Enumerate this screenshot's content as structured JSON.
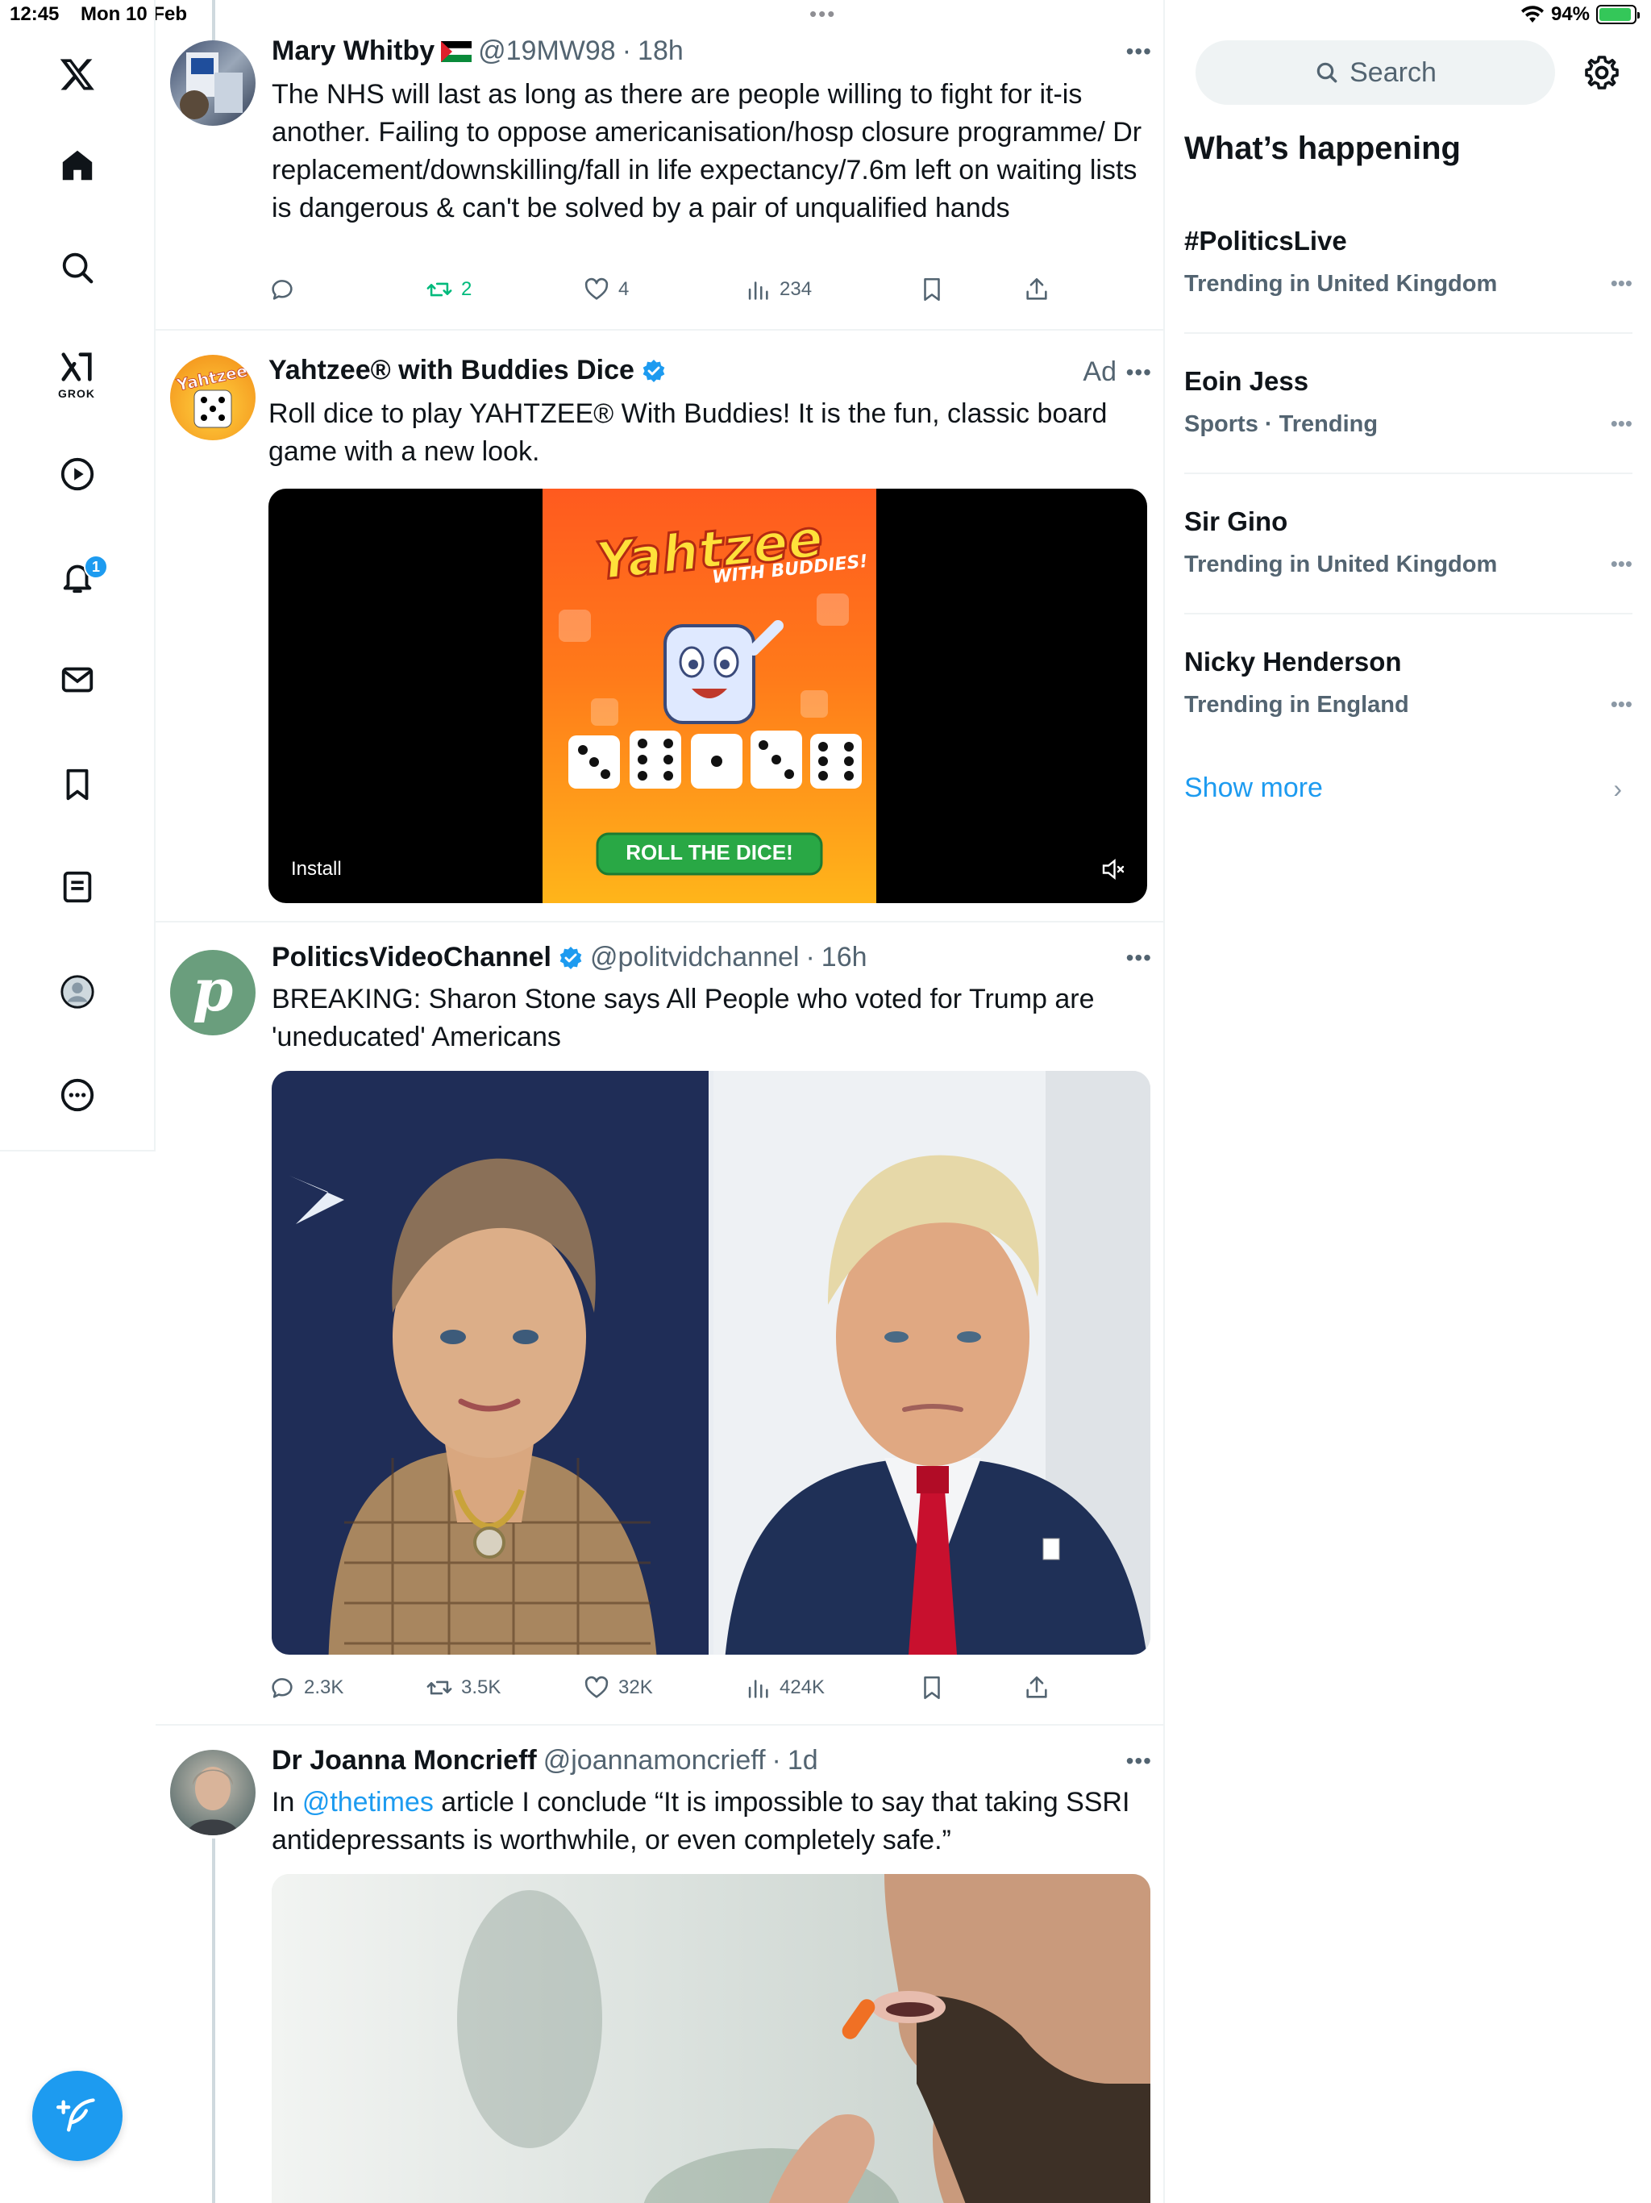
{
  "status_bar": {
    "time": "12:45",
    "date": "Mon 10 Feb",
    "battery": "94%"
  },
  "nav": {
    "grok_label": "GROK",
    "notification_count": "1"
  },
  "tweets": [
    {
      "name": "Mary Whitby",
      "handle": "@19MW98",
      "time": "18h",
      "text": "The NHS will last as long as there are people willing to fight for it-is another. Failing to oppose americanisation/hosp closure programme/ Dr replacement/downskilling/fall in life expectancy/7.6m left on waiting lists is dangerous & can't be solved by a pair of unqualified hands",
      "replies": "",
      "retweets": "2",
      "likes": "4",
      "views": "234"
    },
    {
      "name": "Yahtzee® with Buddies Dice",
      "ad_label": "Ad",
      "text": "Roll dice to play YAHTZEE® With Buddies! It is the fun, classic board game with a new look.",
      "media_logo": "Yahtzee",
      "media_sub": "WITH BUDDIES!",
      "media_cta": "ROLL THE DICE!",
      "install": "Install",
      "avatar_text": "Yahtzee"
    },
    {
      "name": "PoliticsVideoChannel",
      "handle": "@politvidchannel",
      "time": "16h",
      "text": "BREAKING: Sharon Stone says All People who voted for Trump are 'uneducated' Americans",
      "replies": "2.3K",
      "retweets": "3.5K",
      "likes": "32K",
      "views": "424K",
      "avatar_letter": "p"
    },
    {
      "name": "Dr Joanna Moncrieff",
      "handle": "@joannamoncrieff",
      "time": "1d",
      "text_prefix": "In ",
      "mention": "@thetimes",
      "text_suffix": " article I conclude “It is impossible to say that taking SSRI antidepressants is worthwhile, or even completely safe.”"
    }
  ],
  "right": {
    "search_placeholder": "Search",
    "whats_happening": "What’s happening",
    "trends": [
      {
        "name": "#PoliticsLive",
        "meta": "Trending in United Kingdom"
      },
      {
        "name": "Eoin Jess",
        "meta": "Sports · Trending"
      },
      {
        "name": "Sir Gino",
        "meta": "Trending in United Kingdom"
      },
      {
        "name": "Nicky Henderson",
        "meta": "Trending in England"
      }
    ],
    "show_more": "Show more"
  },
  "colors": {
    "accent": "#1d9bf0",
    "retweet_green": "#00ba7c",
    "muted": "#536471",
    "border": "#eff3f4"
  }
}
